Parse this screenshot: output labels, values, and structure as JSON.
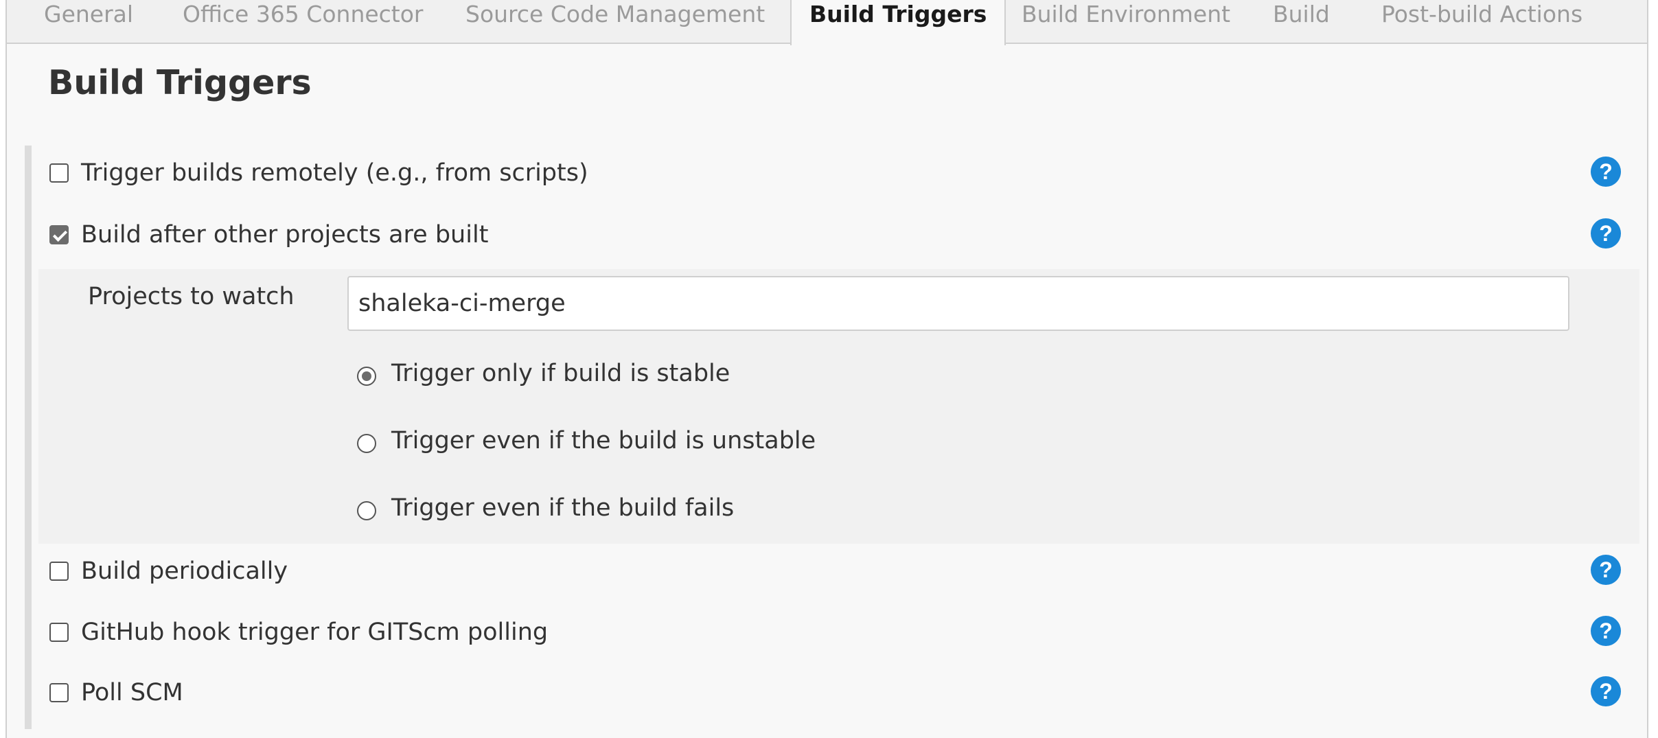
{
  "tabs": [
    {
      "label": "General"
    },
    {
      "label": "Office 365 Connector"
    },
    {
      "label": "Source Code Management"
    },
    {
      "label": "Build Triggers",
      "active": true
    },
    {
      "label": "Build Environment"
    },
    {
      "label": "Build"
    },
    {
      "label": "Post-build Actions"
    }
  ],
  "section": {
    "title": "Build Triggers"
  },
  "triggers": [
    {
      "label": "Trigger builds remotely (e.g., from scripts)",
      "checked": false
    },
    {
      "label": "Build after other projects are built",
      "checked": true
    },
    {
      "label": "Build periodically",
      "checked": false
    },
    {
      "label": "GitHub hook trigger for GITScm polling",
      "checked": false
    },
    {
      "label": "Poll SCM",
      "checked": false
    }
  ],
  "build_after": {
    "projects_label": "Projects to watch",
    "projects_value": "shaleka-ci-merge",
    "options": [
      {
        "label": "Trigger only if build is stable",
        "selected": true
      },
      {
        "label": "Trigger even if the build is unstable",
        "selected": false
      },
      {
        "label": "Trigger even if the build fails",
        "selected": false
      }
    ]
  },
  "help_glyph": "?",
  "colors": {
    "help_icon": "#1a88d8",
    "active_tab_text": "#1a1a1a",
    "inactive_tab_text": "#9a9a9a"
  }
}
